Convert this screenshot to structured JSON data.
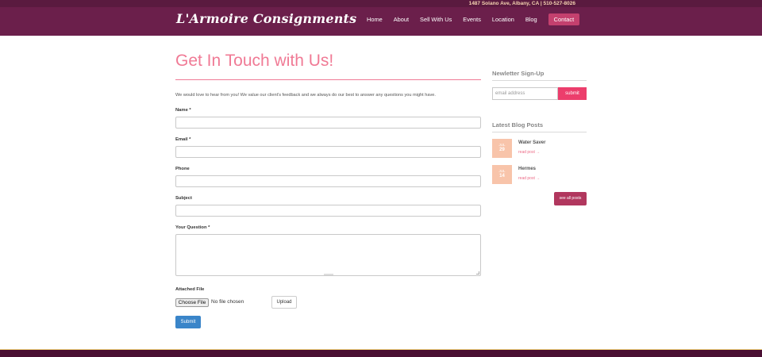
{
  "topbar": {
    "address": "1487 Solano Ave, Albany, CA | 510-527-8026"
  },
  "header": {
    "logo": "L'Armoire Consignments",
    "nav": [
      {
        "label": "Home"
      },
      {
        "label": "About"
      },
      {
        "label": "Sell With Us"
      },
      {
        "label": "Events"
      },
      {
        "label": "Location"
      },
      {
        "label": "Blog"
      },
      {
        "label": "Contact",
        "active": true
      }
    ]
  },
  "main": {
    "title": "Get In Touch with Us!",
    "intro": "We would love to hear from you! We value our client's feedback and we always do our best to answer any questions you might have.",
    "fields": {
      "name_label": "Name *",
      "email_label": "Email *",
      "phone_label": "Phone",
      "subject_label": "Subject",
      "question_label": "Your Question *",
      "file_label": "Attached File"
    },
    "file": {
      "choose_label": "Choose File",
      "status": "No file chosen"
    },
    "upload_label": "Upload",
    "submit_label": "Submit"
  },
  "sidebar": {
    "newsletter": {
      "heading": "Newletter Sign-Up",
      "placeholder": "email address",
      "button": "submit"
    },
    "blog": {
      "heading": "Latest Blog Posts",
      "posts": [
        {
          "month": "JUL",
          "day": "29",
          "title": "Water Saver",
          "link": "read post →"
        },
        {
          "month": "JUL",
          "day": "14",
          "title": "Hermes",
          "link": "read post →"
        }
      ],
      "see_all": "see all posts"
    }
  },
  "colors": {
    "header_bg": "#6b1f4b",
    "title_pink": "#f07a95",
    "submit_blue": "#3a85c9",
    "newsletter_button": "#ec3e6c",
    "date_badge": "#f8c4aa",
    "see_all_button": "#b1375e"
  }
}
